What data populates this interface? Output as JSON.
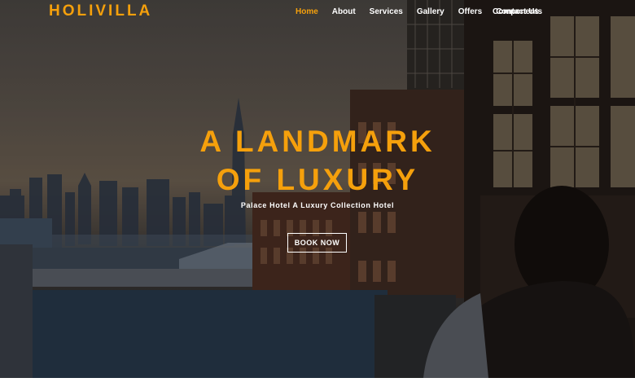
{
  "brand": {
    "name": "HOLIVILLA"
  },
  "nav": {
    "items": [
      {
        "label": "Home",
        "active": true
      },
      {
        "label": "About"
      },
      {
        "label": "Services"
      },
      {
        "label": "Gallery"
      },
      {
        "label": "Offers"
      },
      {
        "label": "Contact Us"
      }
    ],
    "components_label": "Components"
  },
  "hero": {
    "headline_line1": "A LANDMARK",
    "headline_line2": "OF LUXURY",
    "subtitle": "Palace Hotel A Luxury Collection Hotel",
    "button_label": "BOOK NOW"
  },
  "colors": {
    "accent": "#f5a00c",
    "text": "#ffffff"
  }
}
